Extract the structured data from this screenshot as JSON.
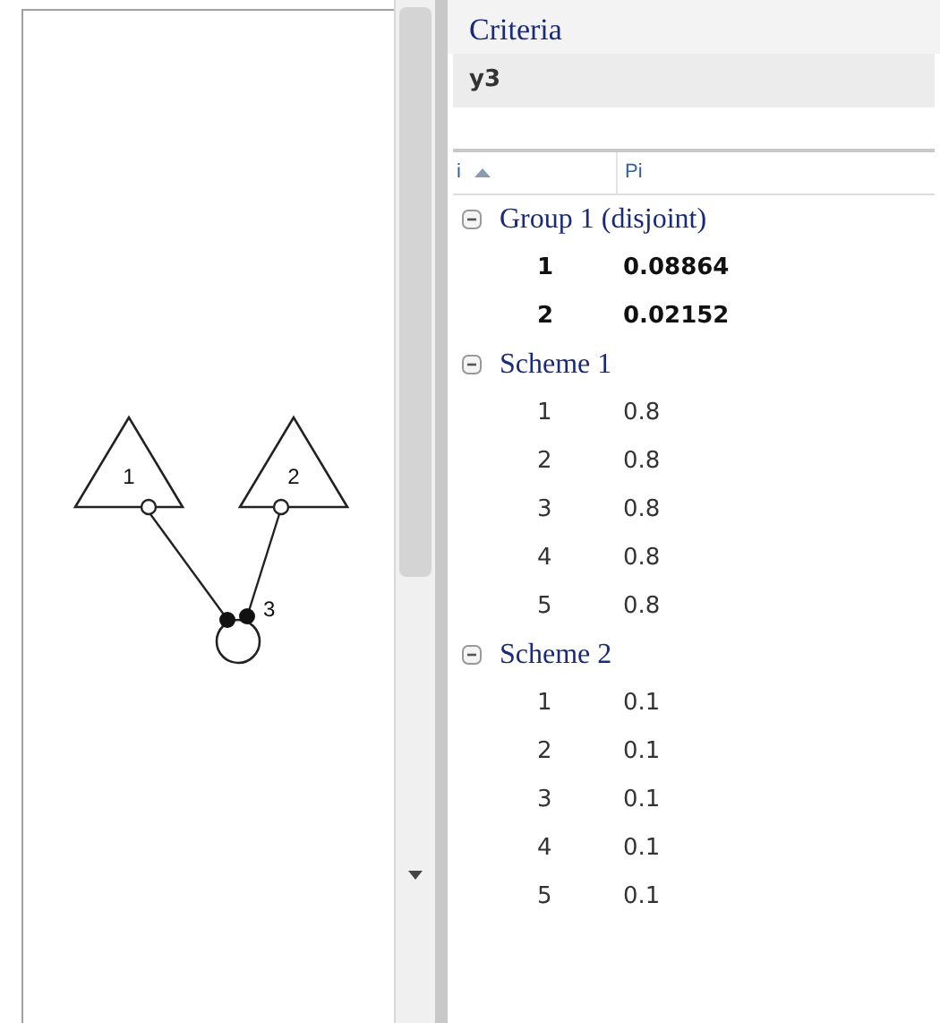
{
  "diagram": {
    "nodes": [
      {
        "kind": "triangle",
        "label": "1"
      },
      {
        "kind": "triangle",
        "label": "2"
      },
      {
        "kind": "circle",
        "label": "3"
      }
    ]
  },
  "criteria": {
    "title": "Criteria",
    "value": "y3"
  },
  "table": {
    "columns": [
      {
        "label": "i",
        "sorted": true
      },
      {
        "label": "Pi",
        "sorted": false
      }
    ],
    "groups": [
      {
        "title": "Group 1 (disjoint)",
        "expanded": true,
        "emphasized": true,
        "rows": [
          [
            "1",
            "0.08864"
          ],
          [
            "2",
            "0.02152"
          ]
        ]
      },
      {
        "title": "Scheme 1",
        "expanded": true,
        "emphasized": false,
        "rows": [
          [
            "1",
            "0.8"
          ],
          [
            "2",
            "0.8"
          ],
          [
            "3",
            "0.8"
          ],
          [
            "4",
            "0.8"
          ],
          [
            "5",
            "0.8"
          ]
        ]
      },
      {
        "title": "Scheme 2",
        "expanded": true,
        "emphasized": false,
        "rows": [
          [
            "1",
            "0.1"
          ],
          [
            "2",
            "0.1"
          ],
          [
            "3",
            "0.1"
          ],
          [
            "4",
            "0.1"
          ],
          [
            "5",
            "0.1"
          ]
        ]
      }
    ]
  }
}
